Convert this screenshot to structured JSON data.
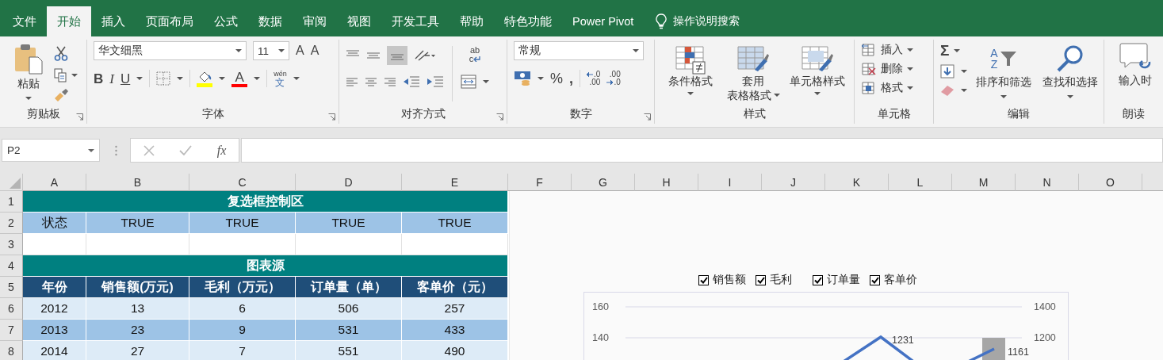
{
  "tabs": [
    {
      "label": "文件",
      "selected": false
    },
    {
      "label": "开始",
      "selected": true
    },
    {
      "label": "插入",
      "selected": false
    },
    {
      "label": "页面布局",
      "selected": false
    },
    {
      "label": "公式",
      "selected": false
    },
    {
      "label": "数据",
      "selected": false
    },
    {
      "label": "审阅",
      "selected": false
    },
    {
      "label": "视图",
      "selected": false
    },
    {
      "label": "开发工具",
      "selected": false
    },
    {
      "label": "帮助",
      "selected": false
    },
    {
      "label": "特色功能",
      "selected": false
    },
    {
      "label": "Power Pivot",
      "selected": false
    }
  ],
  "tell_me": "操作说明搜索",
  "clipboard": {
    "paste": "粘贴",
    "label": "剪贴板"
  },
  "font": {
    "name": "华文细黑",
    "size": "11",
    "grow": "A",
    "shrink": "A",
    "bold": "B",
    "italic": "I",
    "underline": "U",
    "font_color": "A",
    "phonetic_top": "wén",
    "phonetic_bottom": "文",
    "label": "字体"
  },
  "alignment": {
    "wrap_top": "ab",
    "wrap_bottom": "c",
    "label": "对齐方式"
  },
  "number": {
    "format": "常规",
    "percent": "%",
    "comma": ",",
    "increase_decimal": [
      ".0",
      ".00"
    ],
    "decrease_decimal": [
      ".00",
      ".0"
    ],
    "label": "数字"
  },
  "styles": {
    "buttons": [
      {
        "lines": [
          "条件格式"
        ]
      },
      {
        "lines": [
          "套用",
          "表格格式"
        ]
      },
      {
        "lines": [
          "单元格样式"
        ]
      }
    ],
    "label": "样式"
  },
  "cells": {
    "buttons": [
      "插入",
      "删除",
      "格式"
    ],
    "label": "单元格"
  },
  "editing": {
    "sum": "Σ",
    "sort_top": "A",
    "sort_bottom": "Z",
    "buttons": [
      "排序和筛选",
      "查找和选择"
    ],
    "label": "编辑"
  },
  "read_aloud": {
    "button": "输入时",
    "label": "朗读"
  },
  "formula_bar": {
    "name_box": "P2",
    "function": "fx"
  },
  "columns": [
    "A",
    "B",
    "C",
    "D",
    "E",
    "F",
    "G",
    "H",
    "I",
    "J",
    "K",
    "L",
    "M",
    "N",
    "O"
  ],
  "rows": [
    "1",
    "2",
    "3",
    "4",
    "5",
    "6",
    "7",
    "8"
  ],
  "sheet": {
    "control_title": "复选框控制区",
    "status_label": "状态",
    "status_values": [
      "TRUE",
      "TRUE",
      "TRUE",
      "TRUE"
    ],
    "source_title": "图表源",
    "headers": [
      "年份",
      "销售额(万元)",
      "毛利（万元）",
      "订单量（单）",
      "客单价（元）"
    ],
    "data": [
      [
        "2012",
        "13",
        "6",
        "506",
        "257"
      ],
      [
        "2013",
        "23",
        "9",
        "531",
        "433"
      ],
      [
        "2014",
        "27",
        "7",
        "551",
        "490"
      ]
    ]
  },
  "chart": {
    "legend": [
      {
        "label": "销售额",
        "checked": true
      },
      {
        "label": "毛利",
        "checked": true
      },
      {
        "label": "订单量",
        "checked": true
      },
      {
        "label": "客单价",
        "checked": true
      }
    ],
    "left_ticks": [
      "160",
      "140"
    ],
    "right_ticks": [
      "1400",
      "1200"
    ],
    "data_labels": [
      "1231",
      "1161"
    ]
  }
}
